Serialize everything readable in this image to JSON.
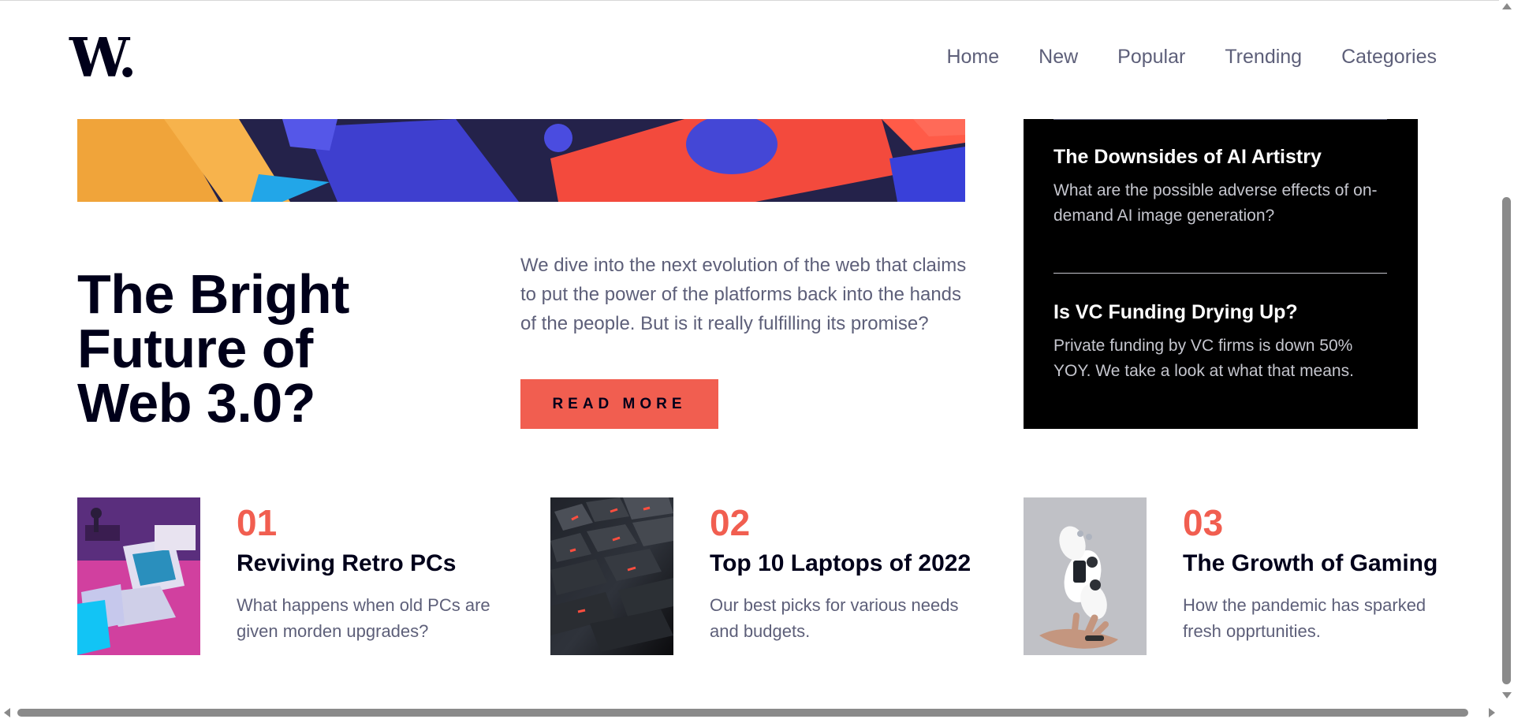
{
  "brand": {
    "logo_text": "W.",
    "colors": {
      "primary_dark": "#00001a",
      "accent_red": "#f15e50",
      "muted_text": "#5d5f79",
      "panel_black": "#000000",
      "panel_text": "#c5c6ce",
      "scrollbar": "#8a8a8a"
    }
  },
  "header": {
    "nav": [
      {
        "label": "Home"
      },
      {
        "label": "New"
      },
      {
        "label": "Popular"
      },
      {
        "label": "Trending"
      },
      {
        "label": "Categories"
      }
    ]
  },
  "hero": {
    "title_line1": "The Bright",
    "title_line2": "Future of",
    "title_line3": "Web 3.0?",
    "description": "We dive into the next evolution of the web that claims to put the power of the platforms back into the hands of the people. But is it really fulfilling its promise?",
    "button_label": "READ MORE"
  },
  "new_panel": {
    "items": [
      {
        "title": "The Downsides of AI Artistry",
        "description": "What are the possible adverse effects of on-demand AI image generation?"
      },
      {
        "title": "Is VC Funding Drying Up?",
        "description": "Private funding by VC firms is down 50% YOY. We take a look at what that means."
      }
    ]
  },
  "articles": [
    {
      "number": "01",
      "title": "Reviving Retro PCs",
      "description": "What happens when old PCs are given morden upgrades?"
    },
    {
      "number": "02",
      "title": "Top 10 Laptops of 2022",
      "description": "Our best picks for various needs and budgets."
    },
    {
      "number": "03",
      "title": "The Growth of Gaming",
      "description": "How the pandemic has sparked fresh opprtunities."
    }
  ]
}
